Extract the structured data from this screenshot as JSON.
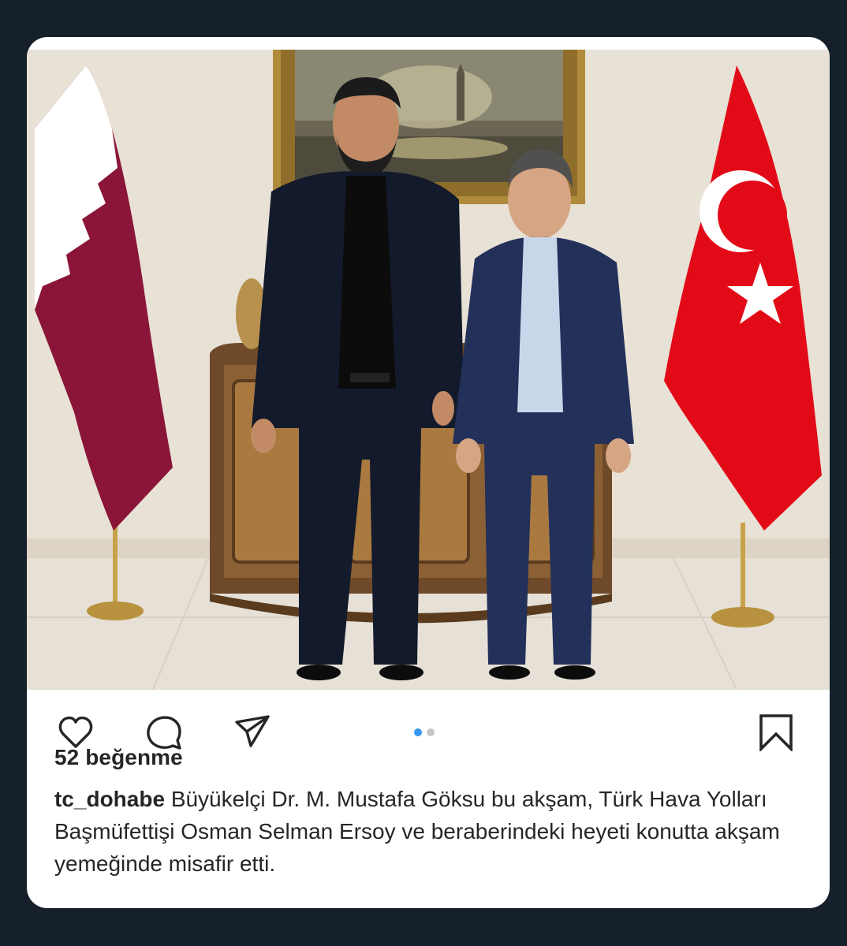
{
  "post": {
    "photo_alt": "Two men standing between a Qatar flag and a Turkey flag in front of a painting",
    "carousel": {
      "count": 2,
      "active": 1
    },
    "likes_text": "52 beğenme",
    "username": "tc_dohabe",
    "caption_text": "Büyükelçi Dr. M. Mustafa Göksu bu akşam, Türk Hava Yolları Başmüfettişi Osman Selman Ersoy ve beraberindeki heyeti konutta akşam yemeğinde misafir etti."
  },
  "icons": {
    "like": "heart-icon",
    "comment": "comment-icon",
    "share": "send-icon",
    "save": "bookmark-icon"
  },
  "colors": {
    "background": "#15202b",
    "card": "#ffffff",
    "text": "#262626",
    "carousel_active": "#3897f0",
    "carousel_inactive": "#c7c7c7",
    "qatar_maroon": "#8a1538",
    "turkey_red": "#e30a17"
  }
}
